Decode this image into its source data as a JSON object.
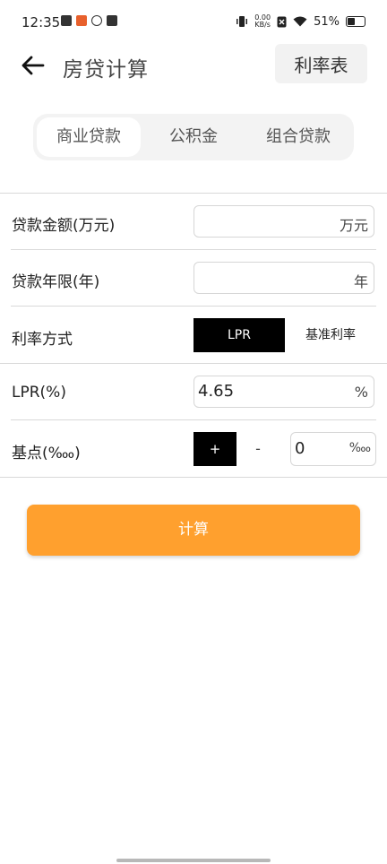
{
  "status_bar": {
    "time": "12:35",
    "net_speed_value": "0.00",
    "net_speed_unit": "KB/s",
    "battery_percent": "51%"
  },
  "app_bar": {
    "title": "房贷计算",
    "rate_table_label": "利率表"
  },
  "tabs": [
    {
      "label": "商业贷款",
      "active": true
    },
    {
      "label": "公积金",
      "active": false
    },
    {
      "label": "组合贷款",
      "active": false
    }
  ],
  "form": {
    "loan_amount": {
      "label": "贷款金额(万元)",
      "value": "",
      "unit": "万元"
    },
    "loan_term": {
      "label": "贷款年限(年)",
      "value": "",
      "unit": "年"
    },
    "rate_method": {
      "label": "利率方式",
      "options": [
        "LPR",
        "基准利率"
      ],
      "selected": "LPR"
    },
    "lpr": {
      "label": "LPR(%)",
      "value": "4.65",
      "unit": "%"
    },
    "basis_points": {
      "label": "基点(‱)",
      "plus": "+",
      "minus": "-",
      "value": "0",
      "unit": "‱"
    }
  },
  "calculate_label": "计算",
  "colors": {
    "accent": "#ffa02e",
    "active_toggle": "#000000",
    "segment_bg": "#f3f3f3"
  }
}
